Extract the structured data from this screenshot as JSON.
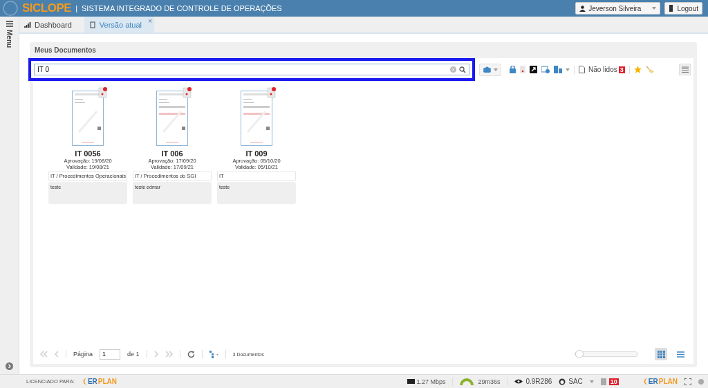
{
  "header": {
    "brand": "SICLOPE",
    "separator": "|",
    "subtitle": "SISTEMA INTEGRADO DE CONTROLE DE OPERAÇÕES",
    "user": "Jeverson Silveira",
    "logout": "Logout"
  },
  "sidebar": {
    "label": "Menu"
  },
  "tabs": [
    {
      "label": "Dashboard",
      "selected": false
    },
    {
      "label": "Versão atual",
      "selected": true,
      "close": "×"
    }
  ],
  "panel": {
    "title": "Meus Documentos",
    "search": {
      "value": "IT 0"
    },
    "toolbar": {
      "unread_label": "Não lidos",
      "unread_count": "3"
    },
    "documents": [
      {
        "code": "IT 0056",
        "approval": "Aprovação: 19/08/20",
        "validity": "Validade: 19/08/21",
        "category": "IT / Procedimentos Operacionais",
        "note": "teste"
      },
      {
        "code": "IT 006",
        "approval": "Aprovação: 17/09/20",
        "validity": "Validade: 17/09/21",
        "category": "IT / Procedimentos do SGI",
        "note": "teste edmar"
      },
      {
        "code": "IT 009",
        "approval": "Aprovação: 05/10/20",
        "validity": "Validade: 05/10/21",
        "category": "IT",
        "note": "teste"
      }
    ],
    "pager": {
      "page_label": "Página",
      "page": "1",
      "of": "de 1",
      "count": "3 Documentos"
    },
    "zoom": {
      "level": 0
    },
    "views": [
      {
        "kind": "grid",
        "selected": true
      },
      {
        "kind": "list",
        "selected": false
      }
    ]
  },
  "footer": {
    "licensed": "LICENCIADO PARA:",
    "logo": {
      "prefix": "ER",
      "suffix": "PLAN"
    },
    "speed": "1.27 Mbps",
    "session": "29m36s",
    "version": "0.9R286",
    "sac": "SAC",
    "alerts": "10",
    "logo_right": {
      "prefix": "ER",
      "suffix": "PLAN"
    }
  }
}
